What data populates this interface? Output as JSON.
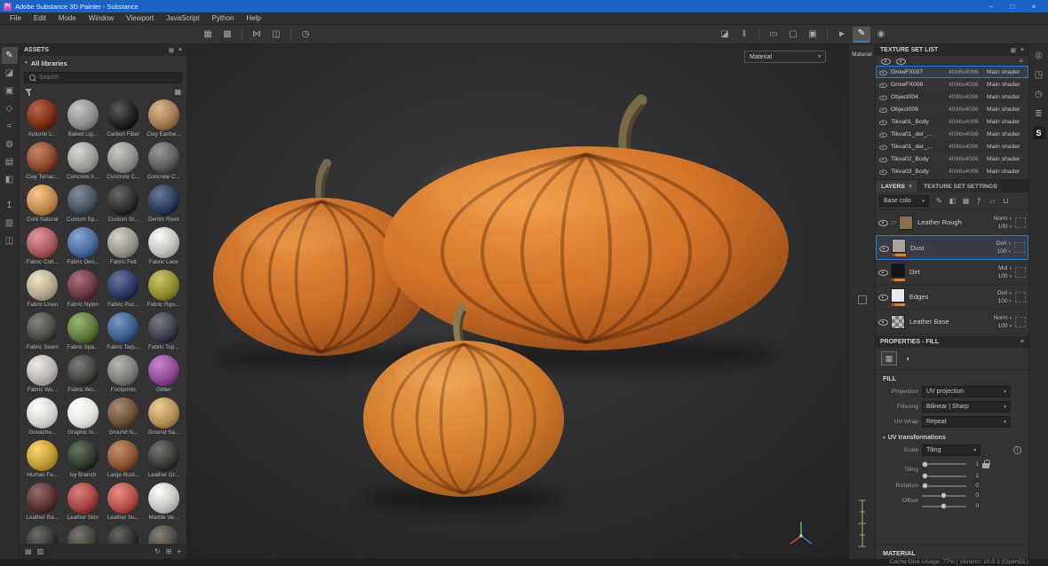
{
  "window": {
    "title": "Adobe Substance 3D Painter - Substance",
    "controls": {
      "minimize": "–",
      "maximize": "□",
      "close": "×"
    }
  },
  "colors": {
    "accent": "#2f7cd6",
    "titlebar_blue": "#1a63c5",
    "layer_channel_orange": "#e0812f",
    "pumpkin_orange": "#cf7027"
  },
  "menu_bar": {
    "items": [
      "File",
      "Edit",
      "Mode",
      "Window",
      "Viewport",
      "JavaScript",
      "Python",
      "Help"
    ]
  },
  "toolbar": {
    "left_icons": [
      {
        "name": "paint-grid-icon",
        "glyph": "▦"
      },
      {
        "name": "stencil-grid-icon",
        "glyph": "▩"
      },
      {
        "name": "sep"
      },
      {
        "name": "symmetry-icon",
        "glyph": "⋈"
      },
      {
        "name": "snap-icon",
        "glyph": "◫"
      },
      {
        "name": "sep"
      },
      {
        "name": "lazy-mouse-icon",
        "glyph": "◷"
      }
    ],
    "right_icons": [
      {
        "name": "perspective-icon",
        "glyph": "◪"
      },
      {
        "name": "pause-engine-icon",
        "glyph": "‖"
      },
      {
        "name": "sep"
      },
      {
        "name": "tablet-icon",
        "glyph": "▭"
      },
      {
        "name": "display-settings-icon",
        "glyph": "▢"
      },
      {
        "name": "camera-settings-icon",
        "glyph": "▣"
      },
      {
        "name": "sep"
      },
      {
        "name": "pointer-icon",
        "glyph": "►"
      },
      {
        "name": "brush-icon",
        "glyph": "✎",
        "active": true
      },
      {
        "name": "capture-icon",
        "glyph": "◉"
      }
    ]
  },
  "tool_strip": [
    {
      "name": "paint-tool",
      "glyph": "✎",
      "active": true
    },
    {
      "name": "eraser-tool",
      "glyph": "◪"
    },
    {
      "name": "projection-tool",
      "glyph": "▣"
    },
    {
      "name": "polygon-fill-tool",
      "glyph": "◇"
    },
    {
      "name": "smudge-tool",
      "glyph": "≈"
    },
    {
      "name": "clone-tool",
      "glyph": "◍"
    },
    {
      "name": "material-picker-tool",
      "glyph": "▤"
    },
    {
      "name": "quick-mask-tool",
      "glyph": "◧"
    },
    {
      "name": "sep"
    },
    {
      "name": "export-icon",
      "glyph": "↥"
    },
    {
      "name": "resources-icon",
      "glyph": "▥"
    },
    {
      "name": "display-toggle-icon",
      "glyph": "◫"
    }
  ],
  "assets_panel": {
    "title": "ASSETS",
    "all_libraries": "All libraries",
    "search_placeholder": "Search",
    "items": [
      {
        "label": "Autumn L...",
        "color": "#7a2e14"
      },
      {
        "label": "Baked Lig...",
        "color": "#8d8d8d"
      },
      {
        "label": "Carbon Fiber",
        "color": "#1f2022"
      },
      {
        "label": "Clay Earthe...",
        "color": "#a07a52"
      },
      {
        "label": "Clay Terrac...",
        "color": "#8a4a2c"
      },
      {
        "label": "Concrete A...",
        "color": "#9b9b97"
      },
      {
        "label": "Concrete C...",
        "color": "#8e8e8a"
      },
      {
        "label": "Concrete C...",
        "color": "#5e5e5c"
      },
      {
        "label": "Cork Natural",
        "color": "#c08a4e"
      },
      {
        "label": "Custom Sp...",
        "color": "#46535f"
      },
      {
        "label": "Custom St...",
        "color": "#2e2e30"
      },
      {
        "label": "Denim Rivet",
        "color": "#2c3d5c"
      },
      {
        "label": "Fabric Cott...",
        "color": "#a85a5e"
      },
      {
        "label": "Fabric Den...",
        "color": "#4a6b9c"
      },
      {
        "label": "Fabric Felt",
        "color": "#98948e"
      },
      {
        "label": "Fabric Lace",
        "color": "#c2c0ba"
      },
      {
        "label": "Fabric Linen",
        "color": "#b3a88e"
      },
      {
        "label": "Fabric Nylon",
        "color": "#6e3842"
      },
      {
        "label": "Fabric Puc...",
        "color": "#2e3a66"
      },
      {
        "label": "Fabric Rips...",
        "color": "#8f8c2e"
      },
      {
        "label": "Fabric Seam",
        "color": "#4c4a46"
      },
      {
        "label": "Fabric Spa...",
        "color": "#5d7a3a"
      },
      {
        "label": "Fabric Tarp...",
        "color": "#3c5c8a"
      },
      {
        "label": "Fabric Top...",
        "color": "#3a3f4a"
      },
      {
        "label": "Fabric Wo...",
        "color": "#b5b2ac"
      },
      {
        "label": "Fabric Wo...",
        "color": "#44423e"
      },
      {
        "label": "Footprints",
        "color": "#7e7c78"
      },
      {
        "label": "Glitter",
        "color": "#8e4a92"
      },
      {
        "label": "Gouache...",
        "color": "#d6d4ce"
      },
      {
        "label": "Graphic to...",
        "color": "#e4e2dc"
      },
      {
        "label": "Ground N...",
        "color": "#6b5136"
      },
      {
        "label": "Ground Sa...",
        "color": "#b29058"
      },
      {
        "label": "Human Fe...",
        "color": "#c09a32"
      },
      {
        "label": "Ivy Branch",
        "color": "#2e3a2a"
      },
      {
        "label": "Large Rust...",
        "color": "#8a5632"
      },
      {
        "label": "Leather Gr...",
        "color": "#3c3a36"
      },
      {
        "label": "Leather Ra...",
        "color": "#5c3230"
      },
      {
        "label": "Leather Skin",
        "color": "#a24442"
      },
      {
        "label": "Leather Su...",
        "color": "#b05048"
      },
      {
        "label": "Marble Ve...",
        "color": "#c6c4c0"
      },
      {
        "label": "",
        "color": "#35332f"
      },
      {
        "label": "",
        "color": "#403c36"
      },
      {
        "label": "",
        "color": "#2e2c28"
      },
      {
        "label": "",
        "color": "#4a463e"
      }
    ]
  },
  "viewport": {
    "shading_dropdown": "Material",
    "display_mode_label": "Material"
  },
  "texture_set_list": {
    "title": "TEXTURE SET LIST",
    "rows": [
      {
        "name": "GrowFX007",
        "res": "4096x4096",
        "shader": "Main shader",
        "selected": true
      },
      {
        "name": "GrowFX008",
        "res": "4096x4096",
        "shader": "Main shader"
      },
      {
        "name": "Object004",
        "res": "4096x4096",
        "shader": "Main shader"
      },
      {
        "name": "Object006",
        "res": "4096x4096",
        "shader": "Main shader"
      },
      {
        "name": "Tikva01_Body",
        "res": "4096x4096",
        "shader": "Main shader"
      },
      {
        "name": "Tikva01_det_...",
        "res": "4096x4096",
        "shader": "Main shader"
      },
      {
        "name": "Tikva01_det_...",
        "res": "4096x4096",
        "shader": "Main shader"
      },
      {
        "name": "Tikva02_Body",
        "res": "4096x4096",
        "shader": "Main shader"
      },
      {
        "name": "Tikva03_Body",
        "res": "4096x4096",
        "shader": "Main shader"
      }
    ]
  },
  "layers_panel": {
    "tab_layers": "LAYERS",
    "tab_settings": "TEXTURE SET SETTINGS",
    "channel_filter": "Base colo",
    "toolbar_icons": [
      {
        "name": "add-paint-layer-icon",
        "glyph": "✎"
      },
      {
        "name": "add-fill-layer-icon",
        "glyph": "◧"
      },
      {
        "name": "add-smart-material-icon",
        "glyph": "▦"
      },
      {
        "name": "add-effect-icon",
        "glyph": "ƒ"
      },
      {
        "name": "add-folder-icon",
        "glyph": "▱"
      },
      {
        "name": "delete-layer-icon",
        "glyph": "⊔"
      }
    ],
    "layers": [
      {
        "name": "Leather Rough",
        "blend": "Norm",
        "opacity": "100",
        "thumb": "#8b7050",
        "folder": true
      },
      {
        "name": "Dust",
        "blend": "Ovrl",
        "opacity": "100",
        "thumb": "#a9a59e",
        "selected": true,
        "bar": true
      },
      {
        "name": "Dirt",
        "blend": "Mul",
        "opacity": "100",
        "thumb": "#141414",
        "bar": true
      },
      {
        "name": "Edges",
        "blend": "Ovrl",
        "opacity": "100",
        "thumb": "#e9e9e9",
        "bar": true
      },
      {
        "name": "Leather Base",
        "blend": "Norm",
        "opacity": "100",
        "thumb": "checker"
      }
    ]
  },
  "properties_panel": {
    "title": "PROPERTIES - FILL",
    "section_fill": "FILL",
    "projection_label": "Projection",
    "projection_value": "UV projection",
    "filtering_label": "Filtering",
    "filtering_value": "Bilinear | Sharp",
    "uv_wrap_label": "UV Wrap",
    "uv_wrap_value": "Repeat",
    "uv_transform_title": "UV transformations",
    "scale_label": "Scale",
    "scale_value": "Tiling",
    "tiling_label": "Tiling",
    "tiling_u": "1",
    "tiling_v": "1",
    "rotation_label": "Rotation",
    "rotation_value": "0",
    "offset_label": "Offset",
    "offset_u": "0",
    "offset_v": "0",
    "section_material": "MATERIAL"
  },
  "far_strip": [
    {
      "name": "display-settings-icon",
      "glyph": "◎"
    },
    {
      "name": "community-assets-icon",
      "glyph": "◳"
    },
    {
      "name": "history-icon",
      "glyph": "◷"
    },
    {
      "name": "shelf-icon",
      "glyph": "≣"
    },
    {
      "name": "substance-logo",
      "glyph": "S",
      "logo": true
    }
  ],
  "status_bar": {
    "text": "Cache Disk Usage: 77% | Version: 10.0.1 (OpenGL)"
  }
}
